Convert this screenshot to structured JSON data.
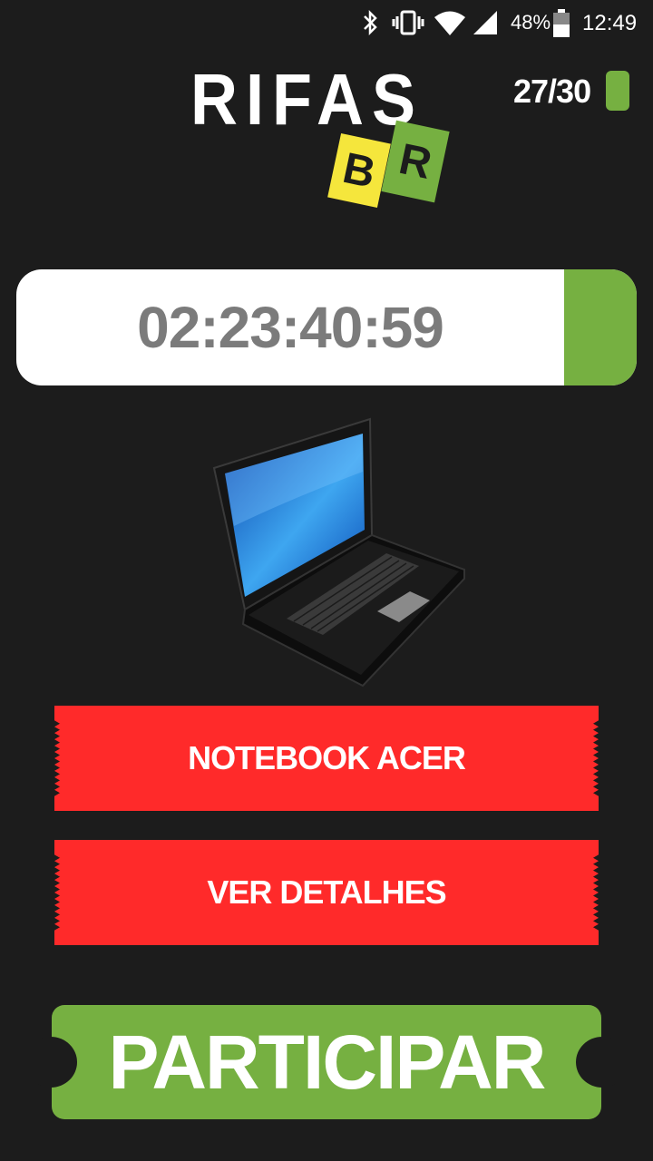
{
  "status_bar": {
    "battery_percent": "48%",
    "time": "12:49",
    "icons": [
      "bluetooth-icon",
      "vibrate-icon",
      "wifi-icon",
      "signal-icon",
      "battery-icon"
    ]
  },
  "header": {
    "logo_text": "RIFAS",
    "logo_ticket_left": "B",
    "logo_ticket_right": "R",
    "counter": "27/30",
    "counter_icon": "ticket-icon"
  },
  "timer": {
    "value": "02:23:40:59"
  },
  "prize": {
    "image_icon": "laptop-image"
  },
  "buttons": {
    "product_label": "NOTEBOOK ACER",
    "details_label": "VER DETALHES",
    "participate_label": "PARTICIPAR"
  },
  "colors": {
    "background": "#1c1c1c",
    "accent_green": "#76b041",
    "accent_red": "#ff2a2a",
    "accent_yellow": "#f5e63c",
    "timer_text": "#7b7b7b"
  }
}
